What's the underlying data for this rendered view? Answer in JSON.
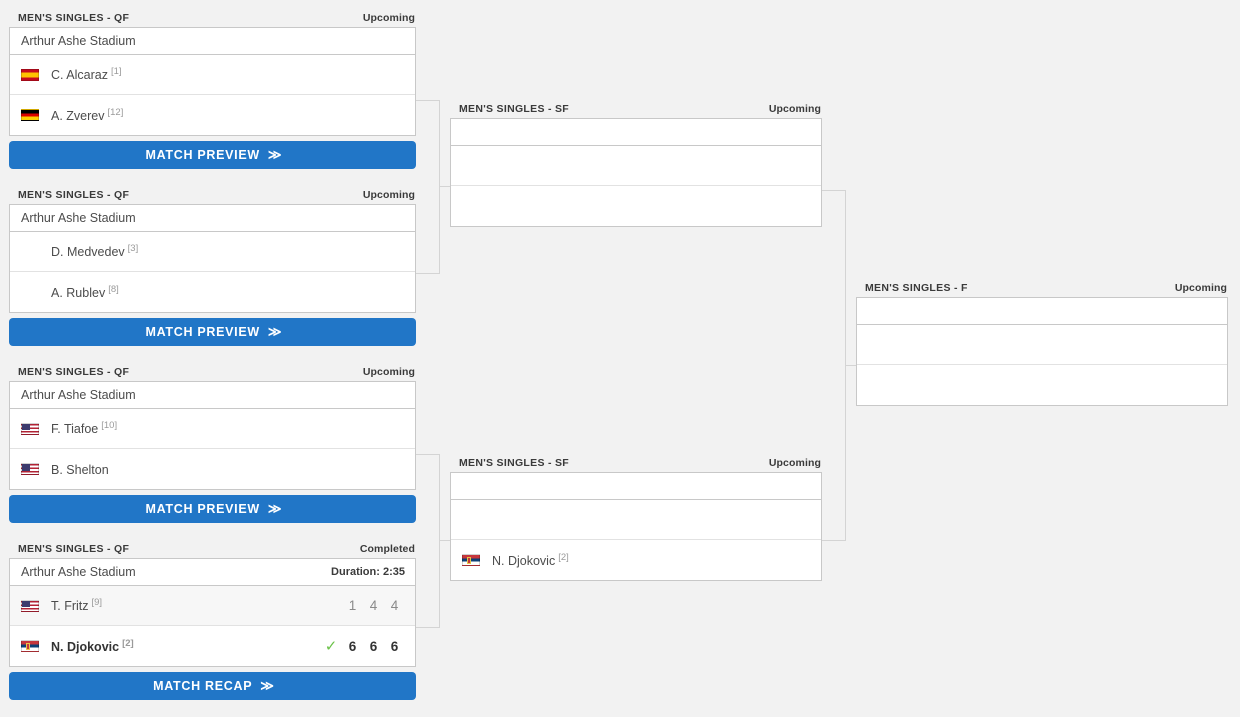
{
  "theme": {
    "page_bg": "#f2f2f2",
    "card_bg": "#ffffff",
    "accent": "#2176c7",
    "win_check": "#6cc24a",
    "border": "#c8c8c8"
  },
  "labels": {
    "round_qf": "MEN'S SINGLES - QF",
    "round_sf": "MEN'S SINGLES - SF",
    "round_f": "MEN'S SINGLES - F",
    "status_upcoming": "Upcoming",
    "status_completed": "Completed",
    "venue": "Arthur Ashe Stadium",
    "btn_preview": "MATCH PREVIEW",
    "btn_recap": "MATCH RECAP",
    "chevron": "≫",
    "check": "✓",
    "empty": ""
  },
  "quarterfinals": [
    {
      "round": "MEN'S SINGLES - QF",
      "status": "Upcoming",
      "venue": "Arthur Ashe Stadium",
      "duration": "",
      "button": "MATCH PREVIEW",
      "players": [
        {
          "flag": "flag-spain",
          "name": "C. Alcaraz",
          "seed": "[1]",
          "winner": false,
          "sets": []
        },
        {
          "flag": "flag-germany",
          "name": "A. Zverev",
          "seed": "[12]",
          "winner": false,
          "sets": []
        }
      ]
    },
    {
      "round": "MEN'S SINGLES - QF",
      "status": "Upcoming",
      "venue": "Arthur Ashe Stadium",
      "duration": "",
      "button": "MATCH PREVIEW",
      "players": [
        {
          "flag": "flag-none",
          "name": "D. Medvedev",
          "seed": "[3]",
          "winner": false,
          "sets": []
        },
        {
          "flag": "flag-none",
          "name": "A. Rublev",
          "seed": "[8]",
          "winner": false,
          "sets": []
        }
      ]
    },
    {
      "round": "MEN'S SINGLES - QF",
      "status": "Upcoming",
      "venue": "Arthur Ashe Stadium",
      "duration": "",
      "button": "MATCH PREVIEW",
      "players": [
        {
          "flag": "flag-usa",
          "name": "F. Tiafoe",
          "seed": "[10]",
          "winner": false,
          "sets": []
        },
        {
          "flag": "flag-usa",
          "name": "B. Shelton",
          "seed": "",
          "winner": false,
          "sets": []
        }
      ]
    },
    {
      "round": "MEN'S SINGLES - QF",
      "status": "Completed",
      "venue": "Arthur Ashe Stadium",
      "duration": "Duration: 2:35",
      "button": "MATCH RECAP",
      "players": [
        {
          "flag": "flag-usa",
          "name": "T. Fritz",
          "seed": "[9]",
          "winner": false,
          "sets": [
            "1",
            "4",
            "4"
          ]
        },
        {
          "flag": "flag-serbia",
          "name": "N. Djokovic",
          "seed": "[2]",
          "winner": true,
          "sets": [
            "6",
            "6",
            "6"
          ]
        }
      ]
    }
  ],
  "semifinals": [
    {
      "round": "MEN'S SINGLES - SF",
      "status": "Upcoming",
      "venue": "",
      "duration": "",
      "players": [
        {
          "flag": "flag-none",
          "name": "",
          "seed": "",
          "winner": false,
          "sets": []
        },
        {
          "flag": "flag-none",
          "name": "",
          "seed": "",
          "winner": false,
          "sets": []
        }
      ]
    },
    {
      "round": "MEN'S SINGLES - SF",
      "status": "Upcoming",
      "venue": "",
      "duration": "",
      "players": [
        {
          "flag": "flag-none",
          "name": "",
          "seed": "",
          "winner": false,
          "sets": []
        },
        {
          "flag": "flag-serbia",
          "name": "N. Djokovic",
          "seed": "[2]",
          "winner": false,
          "sets": []
        }
      ]
    }
  ],
  "final": {
    "round": "MEN'S SINGLES - F",
    "status": "Upcoming",
    "venue": "",
    "duration": "",
    "players": [
      {
        "flag": "flag-none",
        "name": "",
        "seed": "",
        "winner": false,
        "sets": []
      },
      {
        "flag": "flag-none",
        "name": "",
        "seed": "",
        "winner": false,
        "sets": []
      }
    ]
  }
}
